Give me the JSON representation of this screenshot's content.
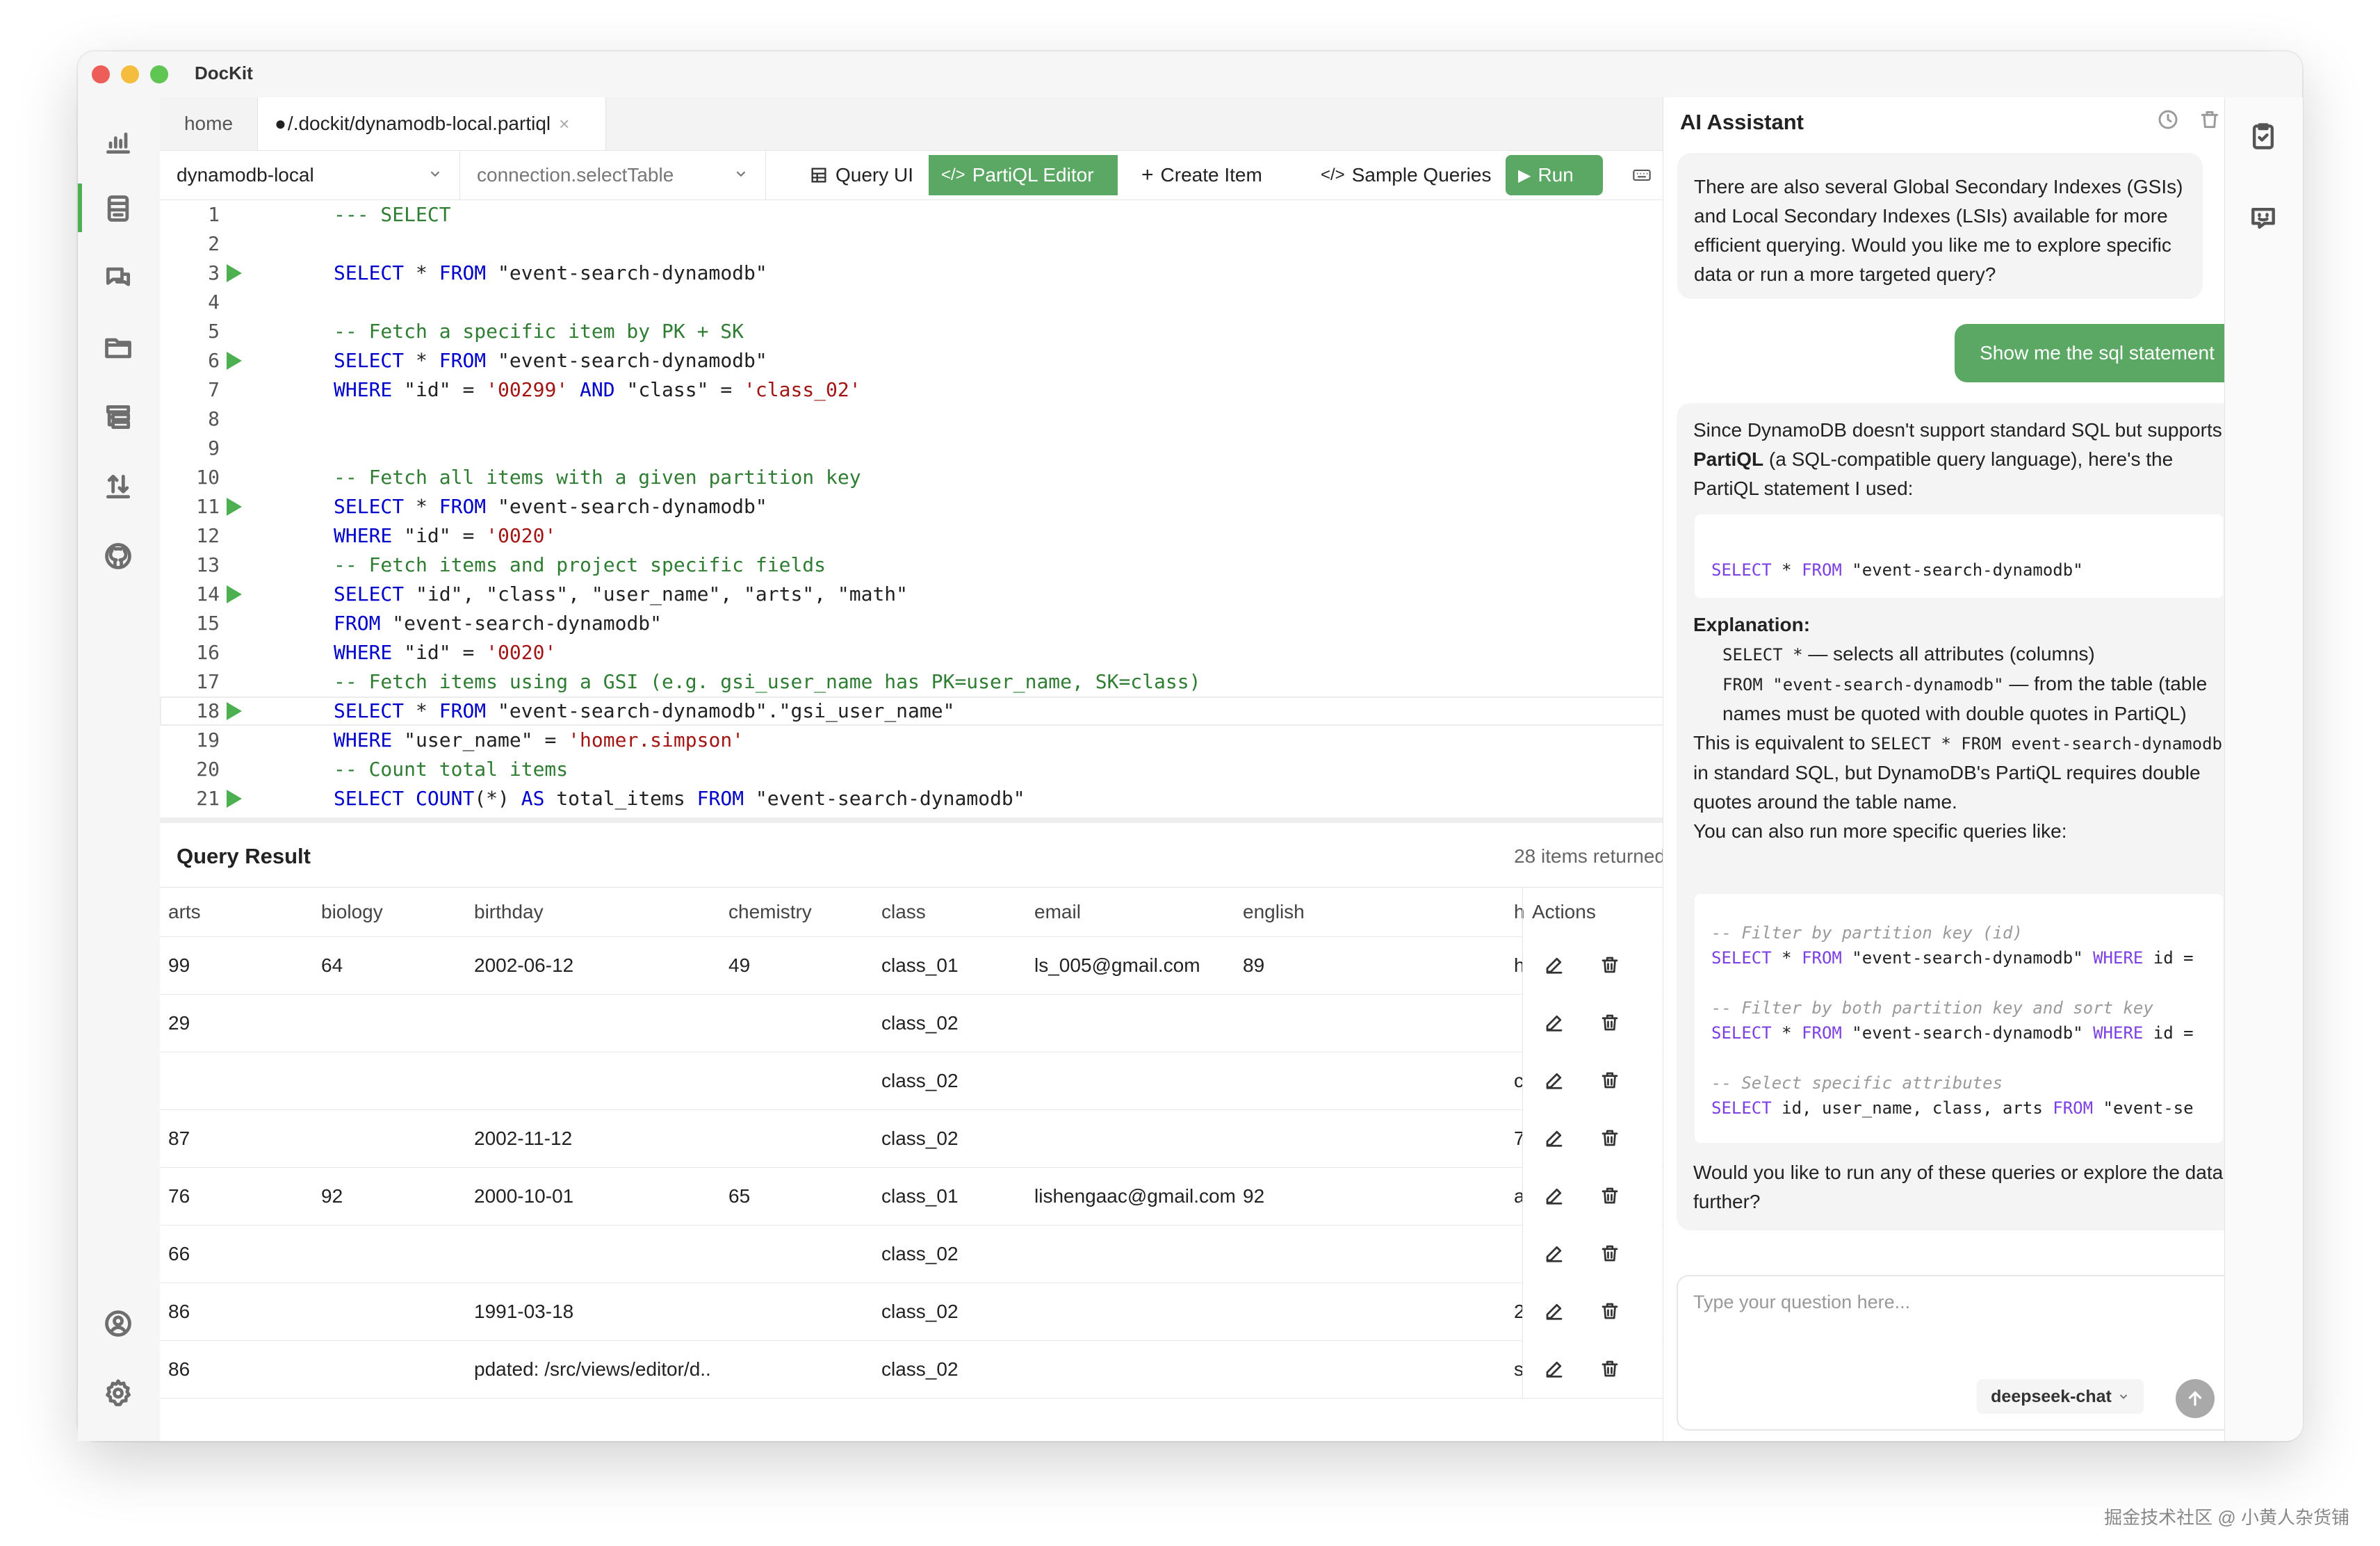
{
  "app": {
    "title": "DocKit"
  },
  "tabs": [
    {
      "label": "home"
    },
    {
      "label": "\u0001/.dockit/dynamodb-local.partiql",
      "display": "/.dockit/dynamodb-local.partiql",
      "close": "×"
    }
  ],
  "toolbar": {
    "connection": "dynamodb-local",
    "table_placeholder": "connection.selectTable",
    "query_ui": "Query UI",
    "partiql_editor": "PartiQL Editor",
    "create_item": "Create Item",
    "sample_queries": "Sample Queries",
    "run": "Run"
  },
  "editor": {
    "lines": [
      {
        "n": "1",
        "run": false,
        "tokens": [
          [
            "cm",
            "--- SELECT"
          ]
        ]
      },
      {
        "n": "2",
        "run": false,
        "tokens": []
      },
      {
        "n": "3",
        "run": true,
        "tokens": [
          [
            "kw",
            "SELECT"
          ],
          [
            "id",
            " * "
          ],
          [
            "kw",
            "FROM"
          ],
          [
            "id",
            " \"event-search-dynamodb\""
          ]
        ]
      },
      {
        "n": "4",
        "run": false,
        "tokens": []
      },
      {
        "n": "5",
        "run": false,
        "tokens": [
          [
            "cm",
            "-- Fetch a specific item by PK + SK"
          ]
        ]
      },
      {
        "n": "6",
        "run": true,
        "tokens": [
          [
            "kw",
            "SELECT"
          ],
          [
            "id",
            " * "
          ],
          [
            "kw",
            "FROM"
          ],
          [
            "id",
            " \"event-search-dynamodb\""
          ]
        ]
      },
      {
        "n": "7",
        "run": false,
        "tokens": [
          [
            "kw",
            "WHERE"
          ],
          [
            "id",
            " \"id\" = "
          ],
          [
            "str",
            "'00299'"
          ],
          [
            "id",
            " "
          ],
          [
            "kw",
            "AND"
          ],
          [
            "id",
            " \"class\" = "
          ],
          [
            "str",
            "'class_02'"
          ]
        ]
      },
      {
        "n": "8",
        "run": false,
        "tokens": []
      },
      {
        "n": "9",
        "run": false,
        "tokens": []
      },
      {
        "n": "10",
        "run": false,
        "tokens": [
          [
            "cm",
            "-- Fetch all items with a given partition key"
          ]
        ]
      },
      {
        "n": "11",
        "run": true,
        "tokens": [
          [
            "kw",
            "SELECT"
          ],
          [
            "id",
            " * "
          ],
          [
            "kw",
            "FROM"
          ],
          [
            "id",
            " \"event-search-dynamodb\""
          ]
        ]
      },
      {
        "n": "12",
        "run": false,
        "tokens": [
          [
            "kw",
            "WHERE"
          ],
          [
            "id",
            " \"id\" = "
          ],
          [
            "str",
            "'0020'"
          ]
        ]
      },
      {
        "n": "13",
        "run": false,
        "tokens": [
          [
            "cm",
            "-- Fetch items and project specific fields"
          ]
        ]
      },
      {
        "n": "14",
        "run": true,
        "tokens": [
          [
            "kw",
            "SELECT"
          ],
          [
            "id",
            " \"id\", \"class\", \"user_name\", \"arts\", \"math\""
          ]
        ]
      },
      {
        "n": "15",
        "run": false,
        "tokens": [
          [
            "kw",
            "FROM"
          ],
          [
            "id",
            " \"event-search-dynamodb\""
          ]
        ]
      },
      {
        "n": "16",
        "run": false,
        "tokens": [
          [
            "kw",
            "WHERE"
          ],
          [
            "id",
            " \"id\" = "
          ],
          [
            "str",
            "'0020'"
          ]
        ]
      },
      {
        "n": "17",
        "run": false,
        "tokens": [
          [
            "cm",
            "-- Fetch items using a GSI (e.g. gsi_user_name has PK=user_name, SK=class)"
          ]
        ]
      },
      {
        "n": "18",
        "run": true,
        "current": true,
        "tokens": [
          [
            "kw",
            "SELECT"
          ],
          [
            "id",
            " * "
          ],
          [
            "kw",
            "FROM"
          ],
          [
            "id",
            " \"event-search-dynamodb\".\"gsi_user_name\""
          ]
        ]
      },
      {
        "n": "19",
        "run": false,
        "tokens": [
          [
            "kw",
            "WHERE"
          ],
          [
            "id",
            " \"user_name\" = "
          ],
          [
            "str",
            "'homer.simpson'"
          ]
        ]
      },
      {
        "n": "20",
        "run": false,
        "tokens": [
          [
            "cm",
            "-- Count total items"
          ]
        ]
      },
      {
        "n": "21",
        "run": true,
        "tokens": [
          [
            "kw",
            "SELECT"
          ],
          [
            "id",
            " "
          ],
          [
            "kw",
            "COUNT"
          ],
          [
            "id",
            "(*) "
          ],
          [
            "kw",
            "AS"
          ],
          [
            "id",
            " total_items "
          ],
          [
            "kw",
            "FROM"
          ],
          [
            "id",
            " \"event-search-dynamodb\""
          ]
        ]
      }
    ]
  },
  "result": {
    "title": "Query Result",
    "count": "28 items returned",
    "close": "×",
    "columns": [
      "arts",
      "biology",
      "birthday",
      "chemistry",
      "class",
      "email",
      "english",
      "h",
      "Actions"
    ],
    "rows": [
      [
        "99",
        "64",
        "2002-06-12",
        "49",
        "class_01",
        "ls_005@gmail.com",
        "89",
        "h"
      ],
      [
        "29",
        "",
        "",
        "",
        "class_02",
        "",
        "",
        ""
      ],
      [
        "",
        "",
        "",
        "",
        "class_02",
        "",
        "",
        "c"
      ],
      [
        "87",
        "",
        "2002-11-12",
        "",
        "class_02",
        "",
        "",
        "7"
      ],
      [
        "76",
        "92",
        "2000-10-01",
        "65",
        "class_01",
        "lishengaac@gmail.com",
        "92",
        "a"
      ],
      [
        "66",
        "",
        "",
        "",
        "class_02",
        "",
        "",
        ""
      ],
      [
        "86",
        "",
        "1991-03-18",
        "",
        "class_02",
        "",
        "",
        "2"
      ],
      [
        "86",
        "",
        "pdated: /src/views/editor/d...",
        "",
        "class_02",
        "",
        "",
        "s"
      ]
    ]
  },
  "assistant": {
    "title": "AI Assistant",
    "msg1": "There are also several Global Secondary Indexes (GSIs) and Local Secondary Indexes (LSIs) available for more efficient querying. Would you like me to explore specific data or run a more targeted query?",
    "user_msg": "Show me the sql statement",
    "msg2_intro_a": "Since DynamoDB doesn't support standard SQL but supports ",
    "msg2_intro_b": "PartiQL",
    "msg2_intro_c": " (a SQL-compatible query language), here's the PartiQL statement I used:",
    "code1_kw1": "SELECT",
    "code1_mid": " * ",
    "code1_kw2": "FROM",
    "code1_str": " \"event-search-dynamodb\"",
    "explanation_label": "Explanation:",
    "bullet1_code": "SELECT *",
    "bullet1_text": " — selects all attributes (columns)",
    "bullet2_code": "FROM \"event-search-dynamodb\"",
    "bullet2_text": " — from the table (table names must be quoted with double quotes in PartiQL)",
    "equiv_a": "This is equivalent to ",
    "equiv_code": "SELECT * FROM event-search-dynamodb",
    "equiv_b": " in standard SQL, but DynamoDB's PartiQL requires double quotes around the table name.",
    "more_queries": "You can also run more specific queries like:",
    "code2": {
      "c1": "-- Filter by partition key (id)",
      "q1_kw1": "SELECT",
      "q1_mid": " * ",
      "q1_kw2": "FROM",
      "q1_str": " \"event-search-dynamodb\" ",
      "q1_kw3": "WHERE",
      "q1_tail": " id =",
      "c2": "-- Filter by both partition key and sort key",
      "q2_kw1": "SELECT",
      "q2_mid": " * ",
      "q2_kw2": "FROM",
      "q2_str": " \"event-search-dynamodb\" ",
      "q2_kw3": "WHERE",
      "q2_tail": " id =",
      "c3": "-- Select specific attributes",
      "q3_kw1": "SELECT",
      "q3_mid": " id, user_name, class, arts ",
      "q3_kw2": "FROM",
      "q3_str": " \"event-se"
    },
    "closing": "Would you like to run any of these queries or explore the data further?",
    "input_placeholder": "Type your question here...",
    "model": "deepseek-chat"
  },
  "watermark": "掘金技术社区 @ 小黄人杂货铺",
  "colors": {
    "accent": "#5aa864",
    "keyword": "#0000cc",
    "string": "#a31515",
    "comment": "#2e7d32"
  }
}
